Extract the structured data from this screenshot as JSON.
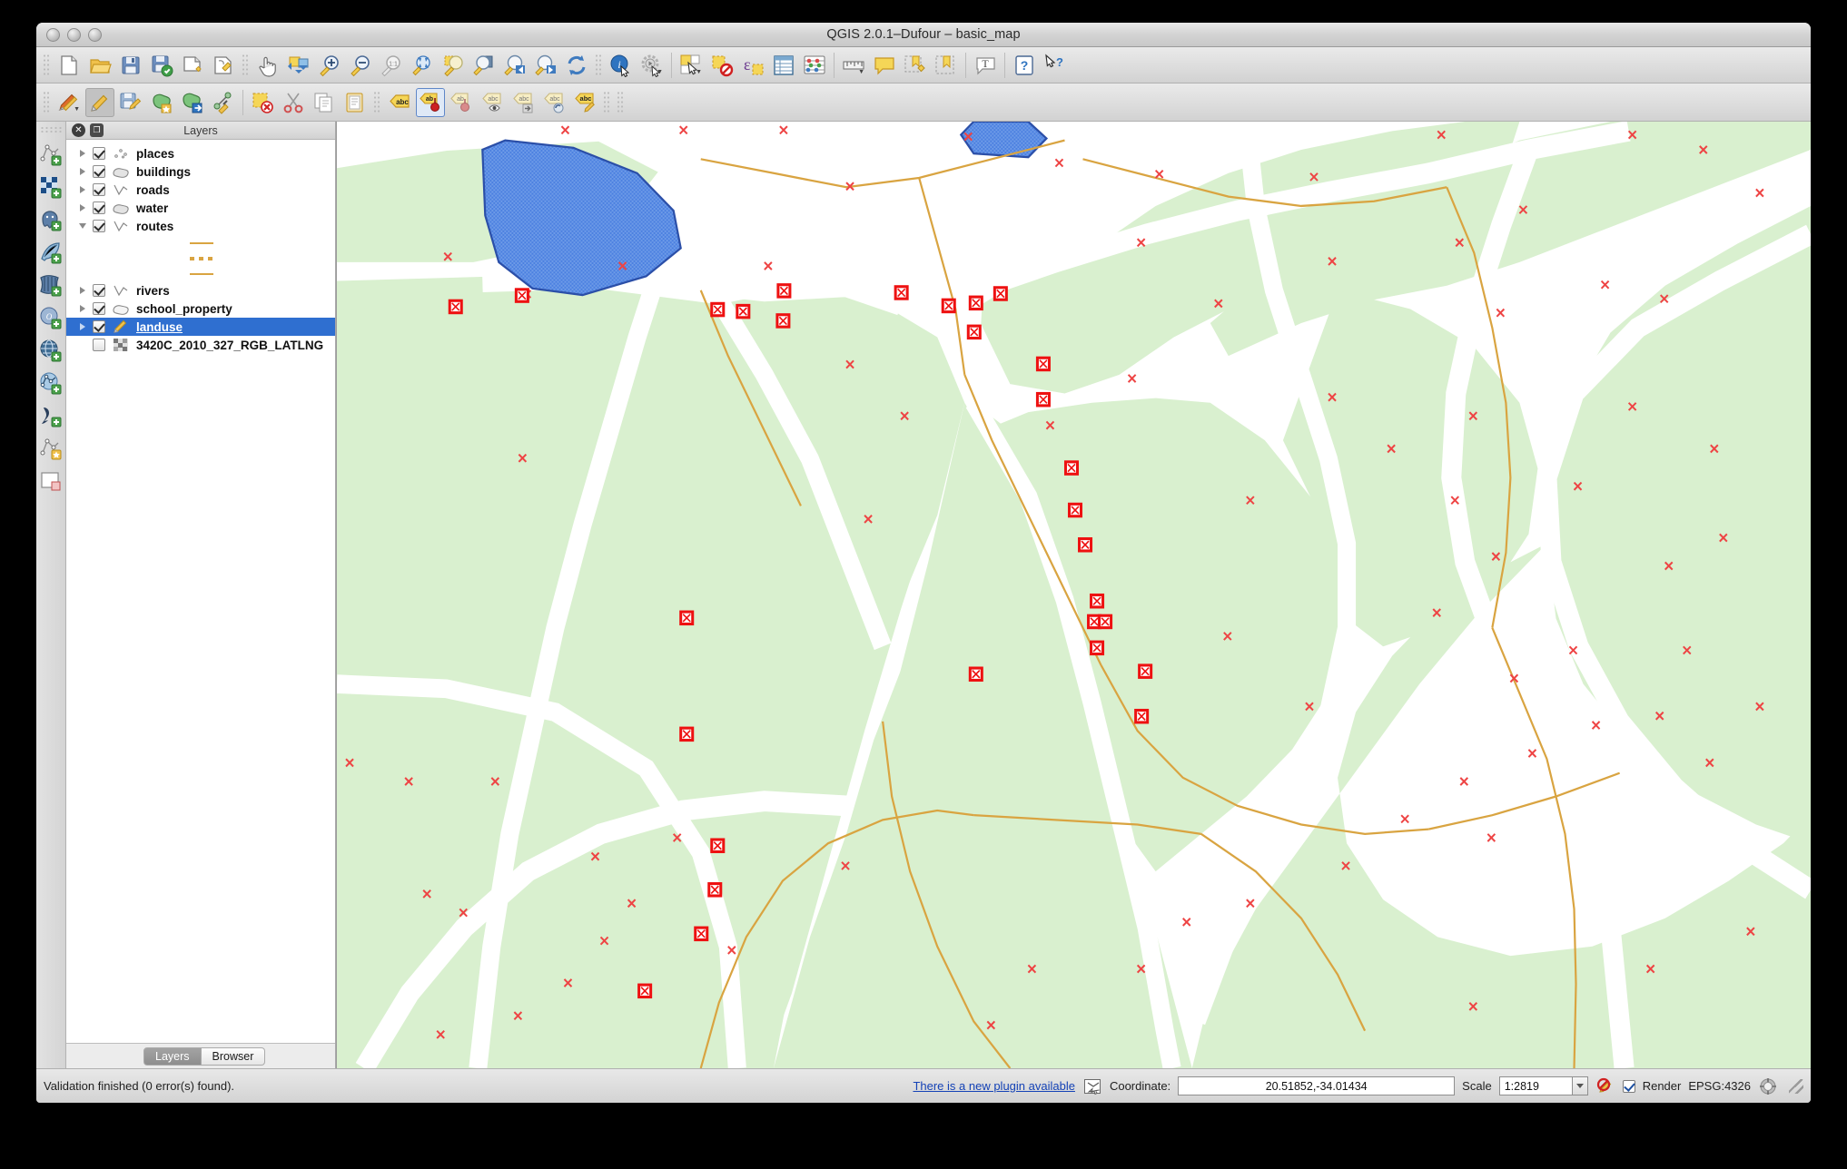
{
  "window": {
    "title": "QGIS 2.0.1–Dufour – basic_map",
    "traffic_lights": [
      "close",
      "minimize",
      "zoom"
    ]
  },
  "toolbar_main": [
    {
      "name": "new-project-icon",
      "label": "New Project"
    },
    {
      "name": "open-project-icon",
      "label": "Open Project"
    },
    {
      "name": "save-project-icon",
      "label": "Save Project"
    },
    {
      "name": "save-project-as-icon",
      "label": "Save Project As"
    },
    {
      "name": "new-print-composer-icon",
      "label": "New Print Composer"
    },
    {
      "name": "composer-manager-icon",
      "label": "Composer Manager"
    },
    {
      "name": "pan-map-icon",
      "label": "Pan Map"
    },
    {
      "name": "pan-to-selection-icon",
      "label": "Pan Map to Selection"
    },
    {
      "name": "zoom-in-icon",
      "label": "Zoom In"
    },
    {
      "name": "zoom-out-icon",
      "label": "Zoom Out"
    },
    {
      "name": "zoom-actual-size-icon",
      "label": "Zoom to Native Resolution"
    },
    {
      "name": "zoom-full-icon",
      "label": "Zoom Full"
    },
    {
      "name": "zoom-to-selection-icon",
      "label": "Zoom to Selection"
    },
    {
      "name": "zoom-to-layer-icon",
      "label": "Zoom to Layer"
    },
    {
      "name": "zoom-last-icon",
      "label": "Zoom Last"
    },
    {
      "name": "zoom-next-icon",
      "label": "Zoom Next"
    },
    {
      "name": "refresh-icon",
      "label": "Refresh"
    },
    {
      "name": "identify-features-icon",
      "label": "Identify Features"
    },
    {
      "name": "run-feature-action-icon",
      "label": "Run Feature Action"
    },
    {
      "name": "select-features-icon",
      "label": "Select Features by Area or Single Click"
    },
    {
      "name": "deselect-features-icon",
      "label": "Deselect Features from All Layers"
    },
    {
      "name": "select-by-expression-icon",
      "label": "Select Features using an Expression"
    },
    {
      "name": "open-attribute-table-icon",
      "label": "Open Attribute Table"
    },
    {
      "name": "open-field-calculator-icon",
      "label": "Open Field Calculator"
    },
    {
      "name": "measure-line-icon",
      "label": "Measure Line"
    },
    {
      "name": "map-tips-icon",
      "label": "Show Map Tips"
    },
    {
      "name": "new-bookmark-icon",
      "label": "New Bookmark"
    },
    {
      "name": "show-bookmarks-icon",
      "label": "Show Bookmarks"
    },
    {
      "name": "text-annotation-icon",
      "label": "Text Annotation"
    },
    {
      "name": "help-icon",
      "label": "Help Contents"
    },
    {
      "name": "whats-this-icon",
      "label": "What's This?"
    }
  ],
  "toolbar_digitizing": [
    {
      "name": "current-edits-icon",
      "label": "Current Edits"
    },
    {
      "name": "toggle-editing-icon",
      "label": "Toggle Editing",
      "state": "active"
    },
    {
      "name": "save-layer-edits-icon",
      "label": "Save Layer Edits"
    },
    {
      "name": "add-feature-icon",
      "label": "Add Feature"
    },
    {
      "name": "move-feature-icon",
      "label": "Move Feature"
    },
    {
      "name": "node-tool-icon",
      "label": "Node Tool"
    },
    {
      "name": "delete-selected-icon",
      "label": "Delete Selected"
    },
    {
      "name": "cut-features-icon",
      "label": "Cut Features"
    },
    {
      "name": "copy-features-icon",
      "label": "Copy Features"
    },
    {
      "name": "paste-features-icon",
      "label": "Paste Features"
    },
    {
      "name": "label-icon",
      "label": "Layer Labeling Options"
    },
    {
      "name": "pin-labels-icon",
      "label": "Pin/Unpin Labels",
      "state": "selected"
    },
    {
      "name": "highlight-labels-icon",
      "label": "Highlight Pinned Labels"
    },
    {
      "name": "show-hide-labels-icon",
      "label": "Show/Hide Labels"
    },
    {
      "name": "move-label-icon",
      "label": "Move Label"
    },
    {
      "name": "rotate-label-icon",
      "label": "Rotate Label"
    },
    {
      "name": "change-label-icon",
      "label": "Change Label"
    }
  ],
  "toolbar_left": [
    {
      "name": "add-vector-layer-icon",
      "label": "Add Vector Layer"
    },
    {
      "name": "add-raster-layer-icon",
      "label": "Add Raster Layer"
    },
    {
      "name": "add-postgis-layer-icon",
      "label": "Add PostGIS Layer"
    },
    {
      "name": "add-spatialite-layer-icon",
      "label": "Add SpatiaLite Layer"
    },
    {
      "name": "add-mssql-layer-icon",
      "label": "Add MSSQL Spatial Layer"
    },
    {
      "name": "add-oracle-layer-icon",
      "label": "Add Oracle Spatial Layer"
    },
    {
      "name": "add-wms-layer-icon",
      "label": "Add WMS/WMTS Layer"
    },
    {
      "name": "add-wfs-layer-icon",
      "label": "Add WFS Layer"
    },
    {
      "name": "add-delimited-text-layer-icon",
      "label": "Add Delimited Text Layer"
    },
    {
      "name": "new-shapefile-layer-icon",
      "label": "New Shapefile Layer"
    },
    {
      "name": "open-style-manager-icon",
      "label": "Style Manager"
    }
  ],
  "panel": {
    "title": "Layers",
    "close_icon": "close-icon",
    "undock_icon": "undock-icon",
    "layers": [
      {
        "name": "places",
        "checked": true,
        "expanded": false,
        "selected": false,
        "icon": "point-layer-icon"
      },
      {
        "name": "buildings",
        "checked": true,
        "expanded": false,
        "selected": false,
        "icon": "polygon-layer-icon"
      },
      {
        "name": "roads",
        "checked": true,
        "expanded": false,
        "selected": false,
        "icon": "line-layer-icon"
      },
      {
        "name": "water",
        "checked": true,
        "expanded": false,
        "selected": false,
        "icon": "polygon-layer-icon"
      },
      {
        "name": "routes",
        "checked": true,
        "expanded": true,
        "selected": false,
        "icon": "line-layer-icon",
        "symbols": [
          {
            "style": "solid",
            "color": "#d9a441"
          },
          {
            "style": "dashed",
            "color": "#d9a441"
          },
          {
            "style": "solid",
            "color": "#d9a441"
          }
        ]
      },
      {
        "name": "rivers",
        "checked": true,
        "expanded": false,
        "selected": false,
        "icon": "line-layer-icon"
      },
      {
        "name": "school_property",
        "checked": true,
        "expanded": false,
        "selected": false,
        "icon": "polygon-layer-icon"
      },
      {
        "name": "landuse",
        "checked": true,
        "expanded": false,
        "selected": true,
        "icon": "edit-pencil-icon"
      },
      {
        "name": "3420C_2010_327_RGB_LATLNG",
        "checked": false,
        "expanded": false,
        "selected": false,
        "icon": "raster-layer-icon"
      }
    ],
    "tabs": [
      {
        "label": "Layers",
        "active": true
      },
      {
        "label": "Browser",
        "active": false
      }
    ]
  },
  "statusbar": {
    "message": "Validation finished (0 error(s) found).",
    "plugin_notice": "There is a new plugin available",
    "messages_icon": "messages-icon",
    "coordinate_label": "Coordinate:",
    "coordinate_value": "20.51852,-34.01434",
    "scale_label": "Scale",
    "scale_value": "1:2819",
    "magnifier_icon": "no-rotation-icon",
    "render_label": "Render",
    "render_checked": true,
    "crs_label": "EPSG:4326",
    "crs_icon": "crs-status-icon"
  },
  "map": {
    "background": "#ffffff",
    "landuse_fill": "#d9f0cf",
    "water_fill": "#4a7fe0",
    "water_stroke": "#2b4fa8",
    "road_stroke": "#d9a441",
    "vertex_marker_color": "#ee1111",
    "x_marker_color": "#ee4444"
  }
}
